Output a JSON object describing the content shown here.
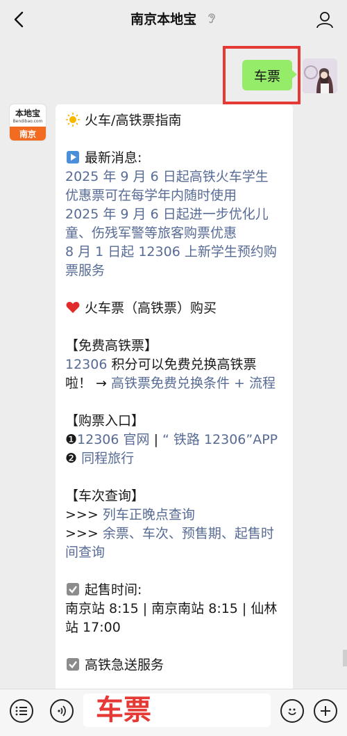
{
  "header": {
    "title": "南京本地宝"
  },
  "outgoing": {
    "text": "车票"
  },
  "bot": {
    "logo_top": "本地宝",
    "logo_sub": "Bendibao.com",
    "logo_city": "南京"
  },
  "message": {
    "title": "火车/高铁票指南",
    "news_heading": "最新消息:",
    "news_links": [
      [
        "2025 年 9 月 6 日起高铁火车学生",
        "优惠票可在每学年内随时使用"
      ],
      [
        "2025 年 9 月 6 日起进一步优化儿",
        "童、伤残军警等旅客购票优惠"
      ],
      [
        "8 月 1 日起 12306 上新学生预约购",
        "票服务"
      ]
    ],
    "buy_heading": "火车票（高铁票）购买",
    "free_heading": "【免费高铁票】",
    "free_link1": "12306",
    "free_text1": " 积分可以免费兑换高铁票",
    "free_text2": "啦！ → ",
    "free_link2": "高铁票免费兑换条件 + 流程",
    "entry_heading": "【购票入口】",
    "entry_num1": "❶",
    "entry_link1": "12306 官网",
    "entry_sep": " | ",
    "entry_link2": "“ 铁路 12306”APP",
    "entry_num2": "❷",
    "entry_link3": "同程旅行",
    "query_heading": "【车次查询】",
    "query_prefix": ">>> ",
    "query_link1": "列车正晚点查询",
    "query_link2a": "余票、车次、预售期、起售时",
    "query_link2b": "间查询",
    "sale_heading": " 起售时间:",
    "sale_line1": "南京站 8:15 | 南京南站 8:15 | 仙林",
    "sale_line2": "站 17:00",
    "express_heading": " 高铁急送服务"
  },
  "input": {
    "value": "车票"
  },
  "icons": {
    "back": "back-chevron-icon",
    "ear": "ear-icon",
    "user": "user-profile-icon",
    "menu": "menu-list-icon",
    "voice": "voice-icon",
    "emoji": "emoji-icon",
    "plus": "plus-icon"
  },
  "colors": {
    "link": "#576b95",
    "bubble_out": "#95ec69",
    "highlight": "#e53935",
    "logo_orange": "#f26b21"
  }
}
